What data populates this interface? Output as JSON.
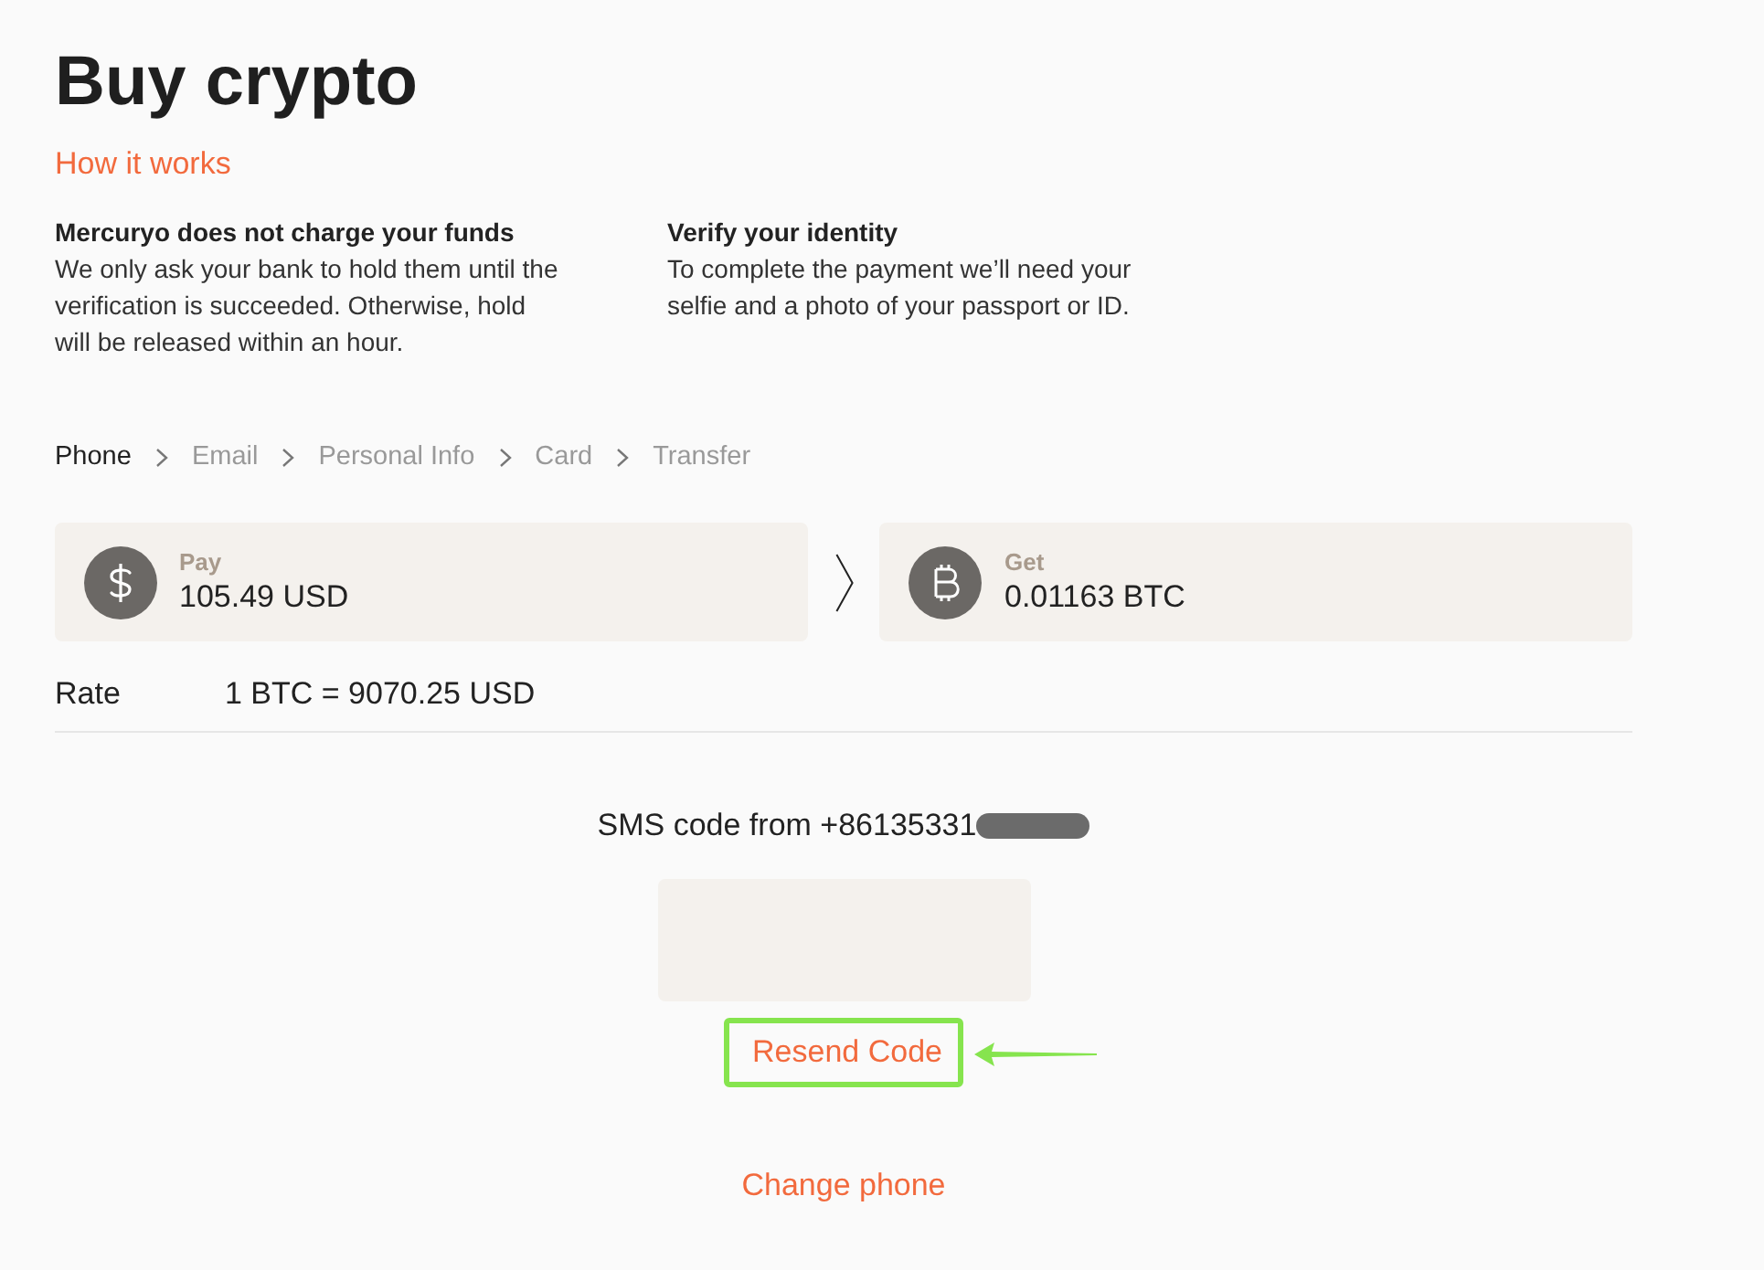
{
  "page": {
    "title": "Buy crypto",
    "help_link": "How it works"
  },
  "info": [
    {
      "heading": "Mercuryo does not charge your funds",
      "body": "We only ask your bank to hold them until the verification is succeeded. Otherwise, hold will be released within an hour."
    },
    {
      "heading": "Verify your identity",
      "body": "To complete the payment we’ll need your selfie and a photo of your passport or ID."
    }
  ],
  "steps": [
    {
      "label": "Phone",
      "selected": true
    },
    {
      "label": "Email",
      "selected": false
    },
    {
      "label": "Personal Info",
      "selected": false
    },
    {
      "label": "Card",
      "selected": false
    },
    {
      "label": "Transfer",
      "selected": false
    }
  ],
  "exchange": [
    {
      "kind": "fiat",
      "label": "Pay",
      "amount": "105.49 USD"
    },
    {
      "kind": "crypto",
      "label": "Get",
      "amount": "0.01163 BTC"
    }
  ],
  "rate": {
    "label": "Rate",
    "value": "1 BTC = 9070.25 USD"
  },
  "verification": {
    "prompt": "SMS code from +86135331",
    "redacted": true,
    "resend": {
      "label": "Resend Code",
      "highlighted": true
    },
    "change_phone": "Change phone"
  }
}
